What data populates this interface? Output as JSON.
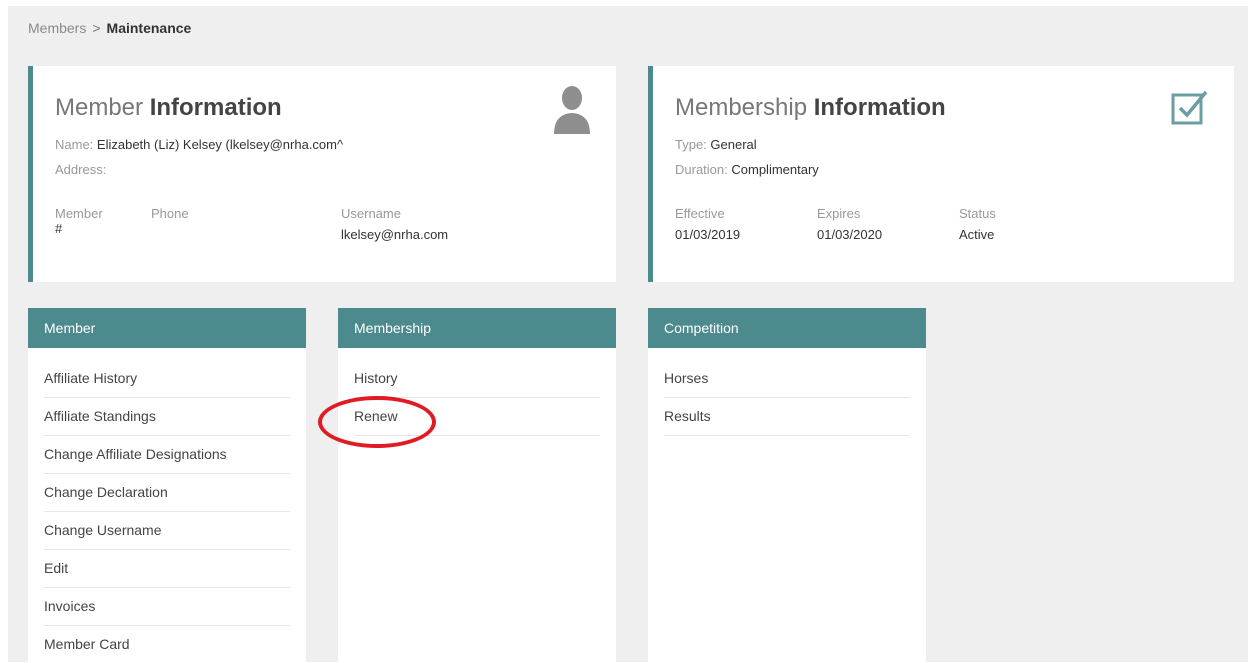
{
  "breadcrumb": {
    "parent": "Members",
    "separator": ">",
    "current": "Maintenance"
  },
  "member_card": {
    "title_light": "Member ",
    "title_bold": "Information",
    "name_label": "Name:",
    "name_value": "Elizabeth (Liz) Kelsey (lkelsey@nrha.com^",
    "address_label": "Address:",
    "member_label": "Member",
    "member_value": "#",
    "phone_label": "Phone",
    "phone_value": "",
    "username_label": "Username",
    "username_value": "lkelsey@nrha.com",
    "icon": "person-icon"
  },
  "membership_card": {
    "title_light": "Membership ",
    "title_bold": "Information",
    "type_label": "Type:",
    "type_value": "General",
    "duration_label": "Duration:",
    "duration_value": "Complimentary",
    "effective_label": "Effective",
    "effective_value": "01/03/2019",
    "expires_label": "Expires",
    "expires_value": "01/03/2020",
    "status_label": "Status",
    "status_value": "Active",
    "icon": "checkbox-icon"
  },
  "panels": {
    "member": {
      "title": "Member",
      "items": [
        "Affiliate History",
        "Affiliate Standings",
        "Change Affiliate Designations",
        "Change Declaration",
        "Change Username",
        "Edit",
        "Invoices",
        "Member Card"
      ]
    },
    "membership": {
      "title": "Membership",
      "items": [
        "History",
        "Renew"
      ]
    },
    "competition": {
      "title": "Competition",
      "items": [
        "Horses",
        "Results"
      ]
    }
  },
  "colors": {
    "accent": "#4d8a8e",
    "highlight": "#e01b24",
    "background": "#efefef"
  }
}
